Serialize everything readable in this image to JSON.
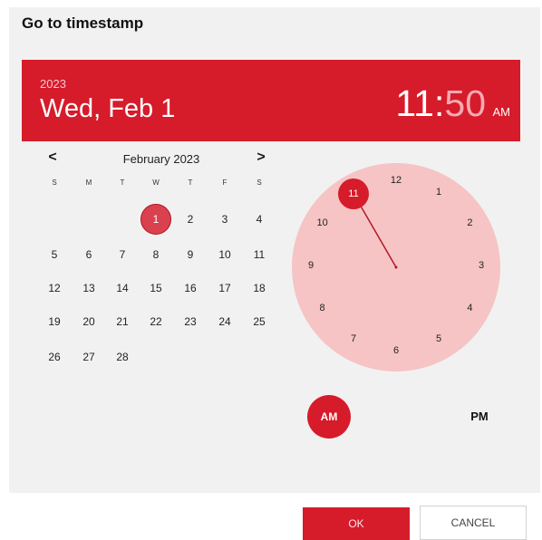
{
  "dialog": {
    "title": "Go to timestamp"
  },
  "header": {
    "year": "2023",
    "date": "Wed, Feb 1",
    "hour": "11",
    "separator": ":",
    "minute": "50",
    "ampm": "AM"
  },
  "calendar": {
    "prev_icon": "chevron-left-icon",
    "next_icon": "chevron-right-icon",
    "prev_glyph": "<",
    "next_glyph": ">",
    "month_label": "February 2023",
    "weekdays": [
      "S",
      "M",
      "T",
      "W",
      "T",
      "F",
      "S"
    ],
    "weeks": [
      [
        "",
        "",
        "",
        "1",
        "2",
        "3",
        "4"
      ],
      [
        "5",
        "6",
        "7",
        "8",
        "9",
        "10",
        "11"
      ],
      [
        "12",
        "13",
        "14",
        "15",
        "16",
        "17",
        "18"
      ],
      [
        "19",
        "20",
        "21",
        "22",
        "23",
        "24",
        "25"
      ],
      [
        "26",
        "27",
        "28",
        "",
        "",
        "",
        ""
      ]
    ],
    "selected_day": "1"
  },
  "clock": {
    "numbers": [
      "12",
      "1",
      "2",
      "3",
      "4",
      "5",
      "6",
      "7",
      "8",
      "9",
      "10",
      "11"
    ],
    "selected_hour": "11",
    "hand_minute": 50,
    "colors": {
      "face": "#f6c4c4",
      "accent": "#d61b2a"
    }
  },
  "period": {
    "am_label": "AM",
    "pm_label": "PM",
    "selected": "AM"
  },
  "buttons": {
    "ok_label": "OK",
    "cancel_label": "CANCEL"
  }
}
